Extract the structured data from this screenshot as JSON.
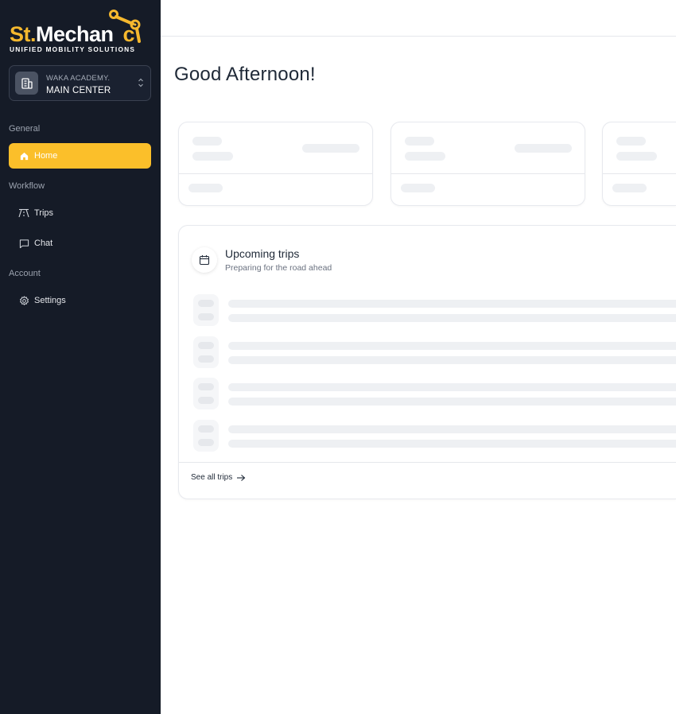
{
  "brand": {
    "logo_part1": "St",
    "logo_part2": ".",
    "logo_part3": "Mechan",
    "logo_part4": "c",
    "tagline": "UNIFIED MOBILITY SOLUTIONS"
  },
  "org": {
    "subtitle": "WAKA ACADEMY.",
    "name": "MAIN CENTER"
  },
  "sidebar": {
    "sections": [
      {
        "label": "General",
        "items": [
          {
            "label": "Home",
            "icon": "home-icon",
            "active": true
          }
        ]
      },
      {
        "label": "Workflow",
        "items": [
          {
            "label": "Trips",
            "icon": "road-icon"
          },
          {
            "label": "Chat",
            "icon": "chat-icon"
          }
        ]
      },
      {
        "label": "Account",
        "items": [
          {
            "label": "Settings",
            "icon": "gear-icon"
          }
        ]
      }
    ]
  },
  "main": {
    "greeting": "Good Afternoon!",
    "upcoming": {
      "title": "Upcoming trips",
      "subtitle": "Preparing for the road ahead",
      "see_all": "See all trips"
    }
  },
  "colors": {
    "sidebar_bg": "#151b27",
    "accent": "#fbbf2a",
    "skeleton": "#eef0f3"
  }
}
